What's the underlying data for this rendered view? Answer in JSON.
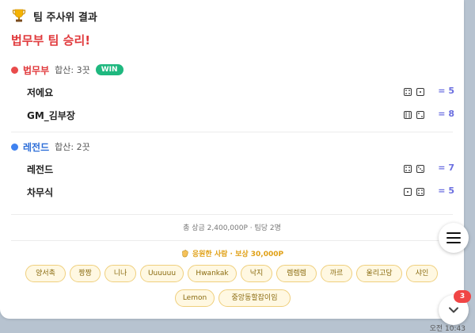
{
  "header": {
    "icon": "trophy-icon",
    "title": "팀 주사위 결과"
  },
  "winner_text": "법무부 팀 승리!",
  "teams": [
    {
      "name": "법무부",
      "color": "#e94b4b",
      "total": "합산: 3끗",
      "badge": "WIN",
      "players": [
        {
          "name": "저에요",
          "dice": [
            4,
            1
          ],
          "sum": "= 5"
        },
        {
          "name": "GM_김부장",
          "dice": [
            6,
            2
          ],
          "sum": "= 8"
        }
      ]
    },
    {
      "name": "레전드",
      "color": "#3f82f0",
      "total": "합산: 2끗",
      "players": [
        {
          "name": "레전드",
          "dice": [
            4,
            3
          ],
          "sum": "= 7"
        },
        {
          "name": "차무식",
          "dice": [
            1,
            4
          ],
          "sum": "= 5"
        }
      ]
    }
  ],
  "footer": {
    "prize_text": "총 상금 2,400,000P · 팀당 2명"
  },
  "supporters": {
    "icon": "waving-hand-icon",
    "title": "응원한 사람 · 보상 30,000P",
    "names": [
      "양서촉",
      "짱짱",
      "니나",
      "Uuuuuu",
      "Hwankak",
      "낙지",
      "렘렘렘",
      "까르",
      "울리고당",
      "샤인",
      "Lemon",
      "중앙동할잡이임"
    ]
  },
  "side_buttons": {
    "menu_icon": "hamburger-menu-icon",
    "scroll_icon": "chevron-down-icon",
    "unread_count": "3"
  },
  "timestamp": "오전 10:43"
}
